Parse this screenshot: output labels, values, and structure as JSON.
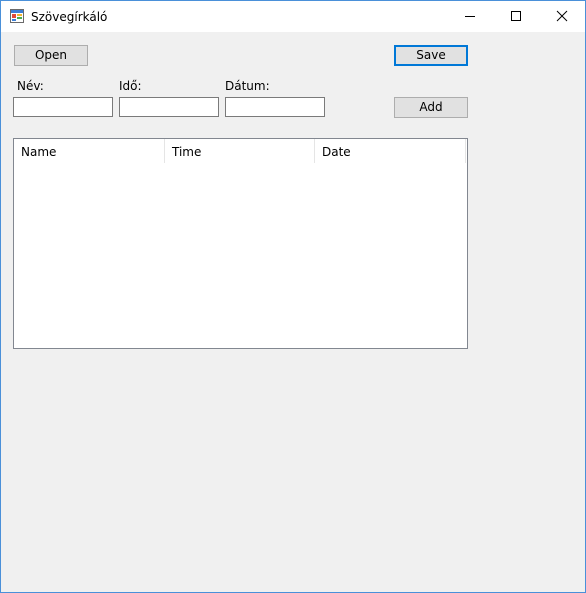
{
  "window": {
    "title": "Szövegírkáló",
    "accent_color": "#0078d7",
    "border_color": "#4a90d9",
    "icons": {
      "app": "app-form-icon",
      "minimize": "minimize-icon",
      "maximize": "maximize-icon",
      "close": "close-icon"
    }
  },
  "toolbar": {
    "open_label": "Open",
    "save_label": "Save",
    "add_label": "Add"
  },
  "fields": {
    "name_label": "Név:",
    "name_value": "",
    "time_label": "Idő:",
    "time_value": "",
    "date_label": "Dátum:",
    "date_value": ""
  },
  "listview": {
    "columns": [
      "Name",
      "Time",
      "Date"
    ],
    "rows": []
  }
}
